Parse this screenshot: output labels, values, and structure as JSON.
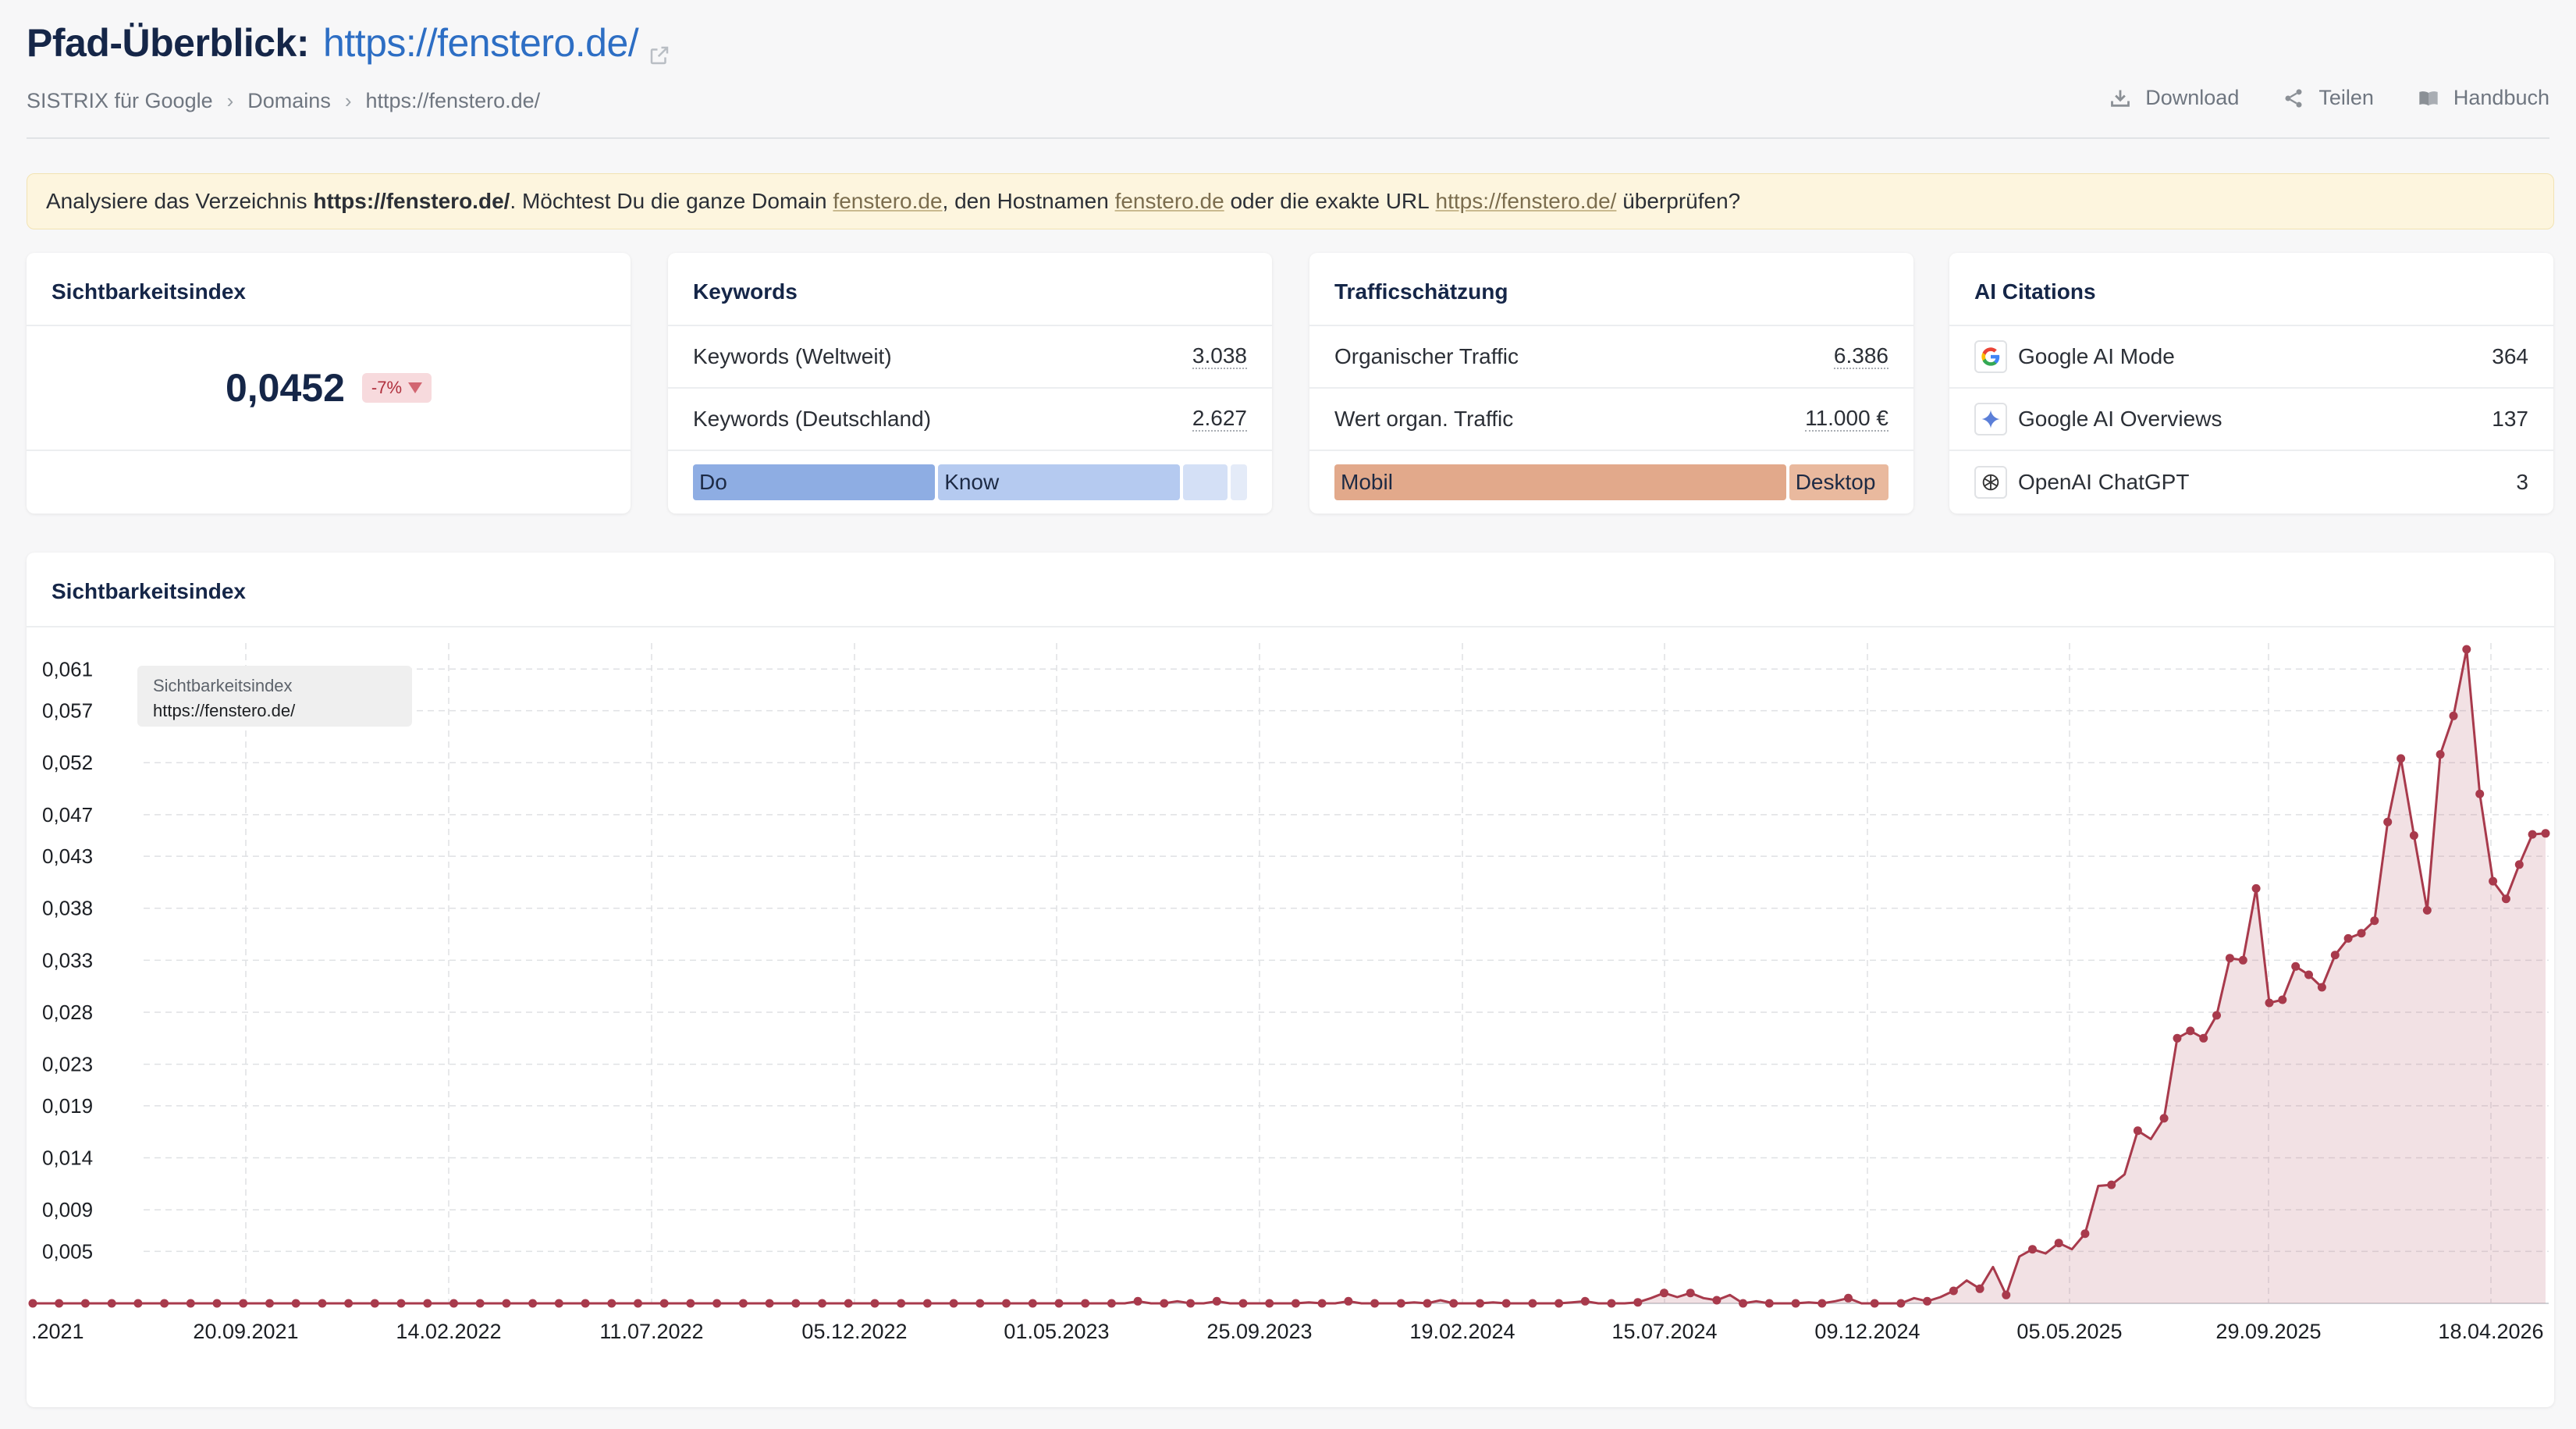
{
  "header": {
    "title": "Pfad-Überblick:",
    "url": "https://fenstero.de/",
    "breadcrumbs": [
      "SISTRIX für Google",
      "Domains",
      "https://fenstero.de/"
    ],
    "actions": [
      "Download",
      "Teilen",
      "Handbuch"
    ]
  },
  "notice": {
    "p1": "Analysiere das Verzeichnis ",
    "path": "https://fenstero.de/",
    "p2": ". Möchtest Du die ganze Domain ",
    "domain": "fenstero.de",
    "p3": ", den Hostnamen ",
    "host": "fenstero.de",
    "p4": " oder die exakte URL ",
    "exact": "https://fenstero.de/",
    "p5": " überprüfen?"
  },
  "visibility": {
    "title": "Sichtbarkeitsindex",
    "value": "0,0452",
    "change": "-7%"
  },
  "keywords": {
    "title": "Keywords",
    "rows": [
      {
        "label": "Keywords (Weltweit)",
        "value": "3.038"
      },
      {
        "label": "Keywords (Deutschland)",
        "value": "2.627"
      }
    ],
    "intent": [
      {
        "label": "Do",
        "share": 0.44,
        "color": "#8eade3"
      },
      {
        "label": "Know",
        "share": 0.44,
        "color": "#b5caf0"
      },
      {
        "label": "",
        "share": 0.08,
        "color": "#d4e0f6"
      },
      {
        "label": "",
        "share": 0.03,
        "color": "#e4ebf8"
      }
    ]
  },
  "traffic": {
    "title": "Trafficschätzung",
    "rows": [
      {
        "label": "Organischer Traffic",
        "value": "6.386"
      },
      {
        "label": "Wert organ. Traffic",
        "value": "11.000 €"
      }
    ],
    "devices": [
      {
        "label": "Mobil",
        "share": 0.82,
        "color": "#e2a98b"
      },
      {
        "label": "Desktop",
        "share": 0.18,
        "color": "#e9b99e"
      }
    ]
  },
  "ai": {
    "title": "AI Citations",
    "rows": [
      {
        "label": "Google AI Mode",
        "value": "364",
        "icon": "google-icon"
      },
      {
        "label": "Google AI Overviews",
        "value": "137",
        "icon": "sparkle-icon"
      },
      {
        "label": "OpenAI ChatGPT",
        "value": "3",
        "icon": "openai-icon"
      }
    ]
  },
  "chart_title": "Sichtbarkeitsindex",
  "tooltip": {
    "line1": "Sichtbarkeitsindex",
    "line2": "https://fenstero.de/"
  },
  "chart_data": {
    "type": "area",
    "title": "Sichtbarkeitsindex",
    "series": [
      {
        "name": "https://fenstero.de/",
        "color": "#a83a4c"
      }
    ],
    "y_ticks": [
      "0,061",
      "0,057",
      "0,052",
      "0,047",
      "0,043",
      "0,038",
      "0,033",
      "0,028",
      "0,023",
      "0,019",
      "0,014",
      "0,009",
      "0,005"
    ],
    "y_tick_values": [
      0.061,
      0.057,
      0.052,
      0.047,
      0.043,
      0.038,
      0.033,
      0.028,
      0.023,
      0.019,
      0.014,
      0.009,
      0.005
    ],
    "x_ticks": [
      ".2021",
      "20.09.2021",
      "14.02.2022",
      "11.07.2022",
      "05.12.2022",
      "01.05.2023",
      "25.09.2023",
      "19.02.2024",
      "15.07.2024",
      "09.12.2024",
      "05.05.2025",
      "29.09.2025",
      "18.04.2026"
    ],
    "ylim": [
      0,
      0.0635
    ],
    "grid": true,
    "weekly_points": 175,
    "values": [
      0,
      0,
      0,
      0,
      0,
      0,
      0,
      0,
      0,
      0,
      0,
      0,
      0,
      0,
      0,
      0,
      0,
      0,
      0,
      0,
      0,
      0,
      0,
      0,
      0,
      0,
      0,
      0,
      0,
      0,
      0,
      0,
      0,
      0,
      0,
      0,
      0,
      0,
      0,
      0,
      0,
      0,
      0,
      0,
      0,
      0,
      0,
      0,
      0,
      0,
      0,
      0,
      0,
      0,
      0,
      0,
      0,
      0,
      0,
      0,
      0,
      0,
      0,
      0,
      0,
      0,
      0,
      0,
      0,
      0,
      0,
      0,
      0,
      0,
      0,
      0,
      0,
      0,
      0,
      0,
      0,
      0,
      0,
      0,
      0.0002,
      0,
      0,
      0.0002,
      0,
      0,
      0.0002,
      0,
      0,
      0,
      0,
      0,
      0,
      0.0001,
      0,
      0,
      0.0002,
      0,
      0,
      0,
      0,
      0.0001,
      0,
      0.0003,
      0,
      0,
      0,
      0.0001,
      0,
      0,
      0,
      0,
      0,
      0.0001,
      0.0002,
      0,
      0,
      0,
      0.0001,
      0.0005,
      0.001,
      0.0006,
      0.001,
      0.0005,
      0.0003,
      0.0008,
      0,
      0.0002,
      0,
      0,
      0,
      0.0001,
      0,
      0.0002,
      0.0005,
      0,
      0,
      0,
      0,
      0.0005,
      0.0002,
      0.0006,
      0.0012,
      0.0022,
      0.0014,
      0.0035,
      0.0008,
      0.0045,
      0.0052,
      0.0048,
      0.0058,
      0.0052,
      0.0067,
      0.0113,
      0.0114,
      0.0124,
      0.0166,
      0.0158,
      0.0178,
      0.0255,
      0.0262,
      0.0255,
      0.0277,
      0.0332,
      0.033,
      0.0399,
      0.0289,
      0.0292,
      0.0324,
      0.0316,
      0.0304,
      0.0335,
      0.0351,
      0.0356,
      0.0368,
      0.0463,
      0.0524,
      0.045,
      0.0378,
      0.0528,
      0.0565,
      0.0629,
      0.049,
      0.0406,
      0.0389,
      0.0422,
      0.0451,
      0.0452
    ]
  }
}
